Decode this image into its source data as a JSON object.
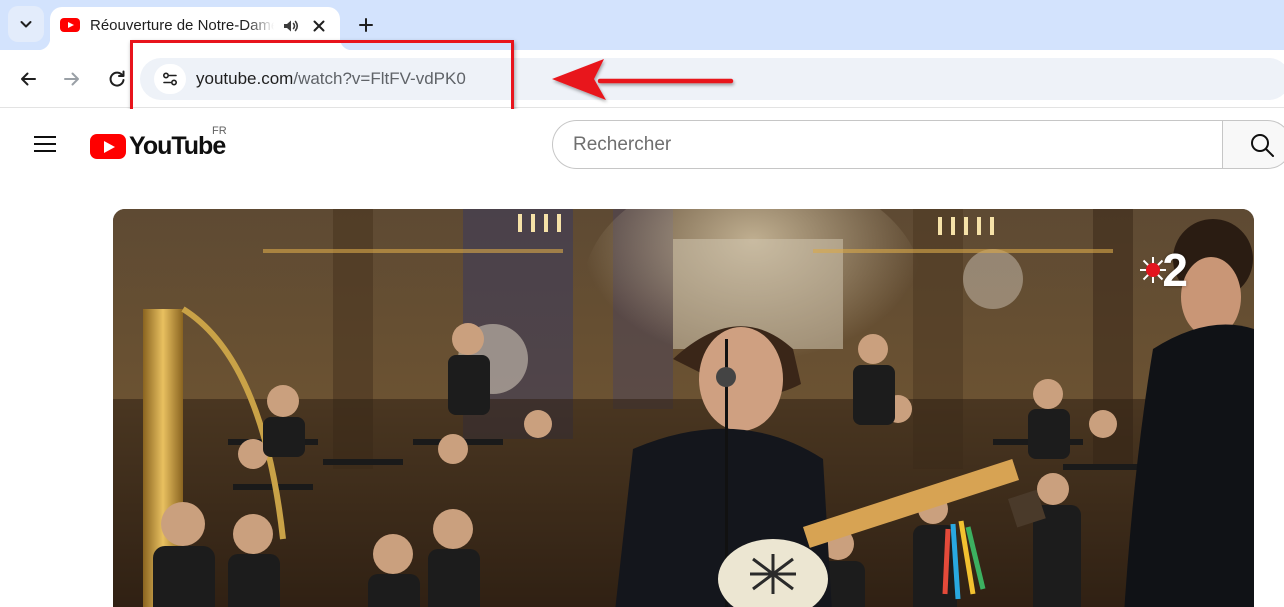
{
  "browser": {
    "tab": {
      "title": "Réouverture de Notre-Dame de Paris",
      "favicon": "youtube-favicon-icon",
      "audio_icon": "speaker-icon",
      "close_icon": "close-icon"
    },
    "new_tab_icon": "plus-icon",
    "tab_list_icon": "chevron-down-icon",
    "nav": {
      "back_icon": "arrow-left-icon",
      "forward_icon": "arrow-right-icon",
      "reload_icon": "reload-icon"
    },
    "omnibox": {
      "host": "youtube.com",
      "path": "/watch?v=FltFV-vdPK0",
      "site_info_icon": "tune-icon"
    }
  },
  "annotation": {
    "color": "#e8141c",
    "shape": "rectangle-and-arrow"
  },
  "youtube": {
    "menu_icon": "hamburger-icon",
    "logo_text": "YouTube",
    "country_code": "FR",
    "search": {
      "placeholder": "Rechercher",
      "icon": "search-icon"
    },
    "video": {
      "channel_badge": "2",
      "badge_icon": "sunburst-icon"
    }
  },
  "colors": {
    "tabstrip": "#d3e3fd",
    "omnibox": "#eef2f8",
    "youtube_red": "#ff0000"
  }
}
